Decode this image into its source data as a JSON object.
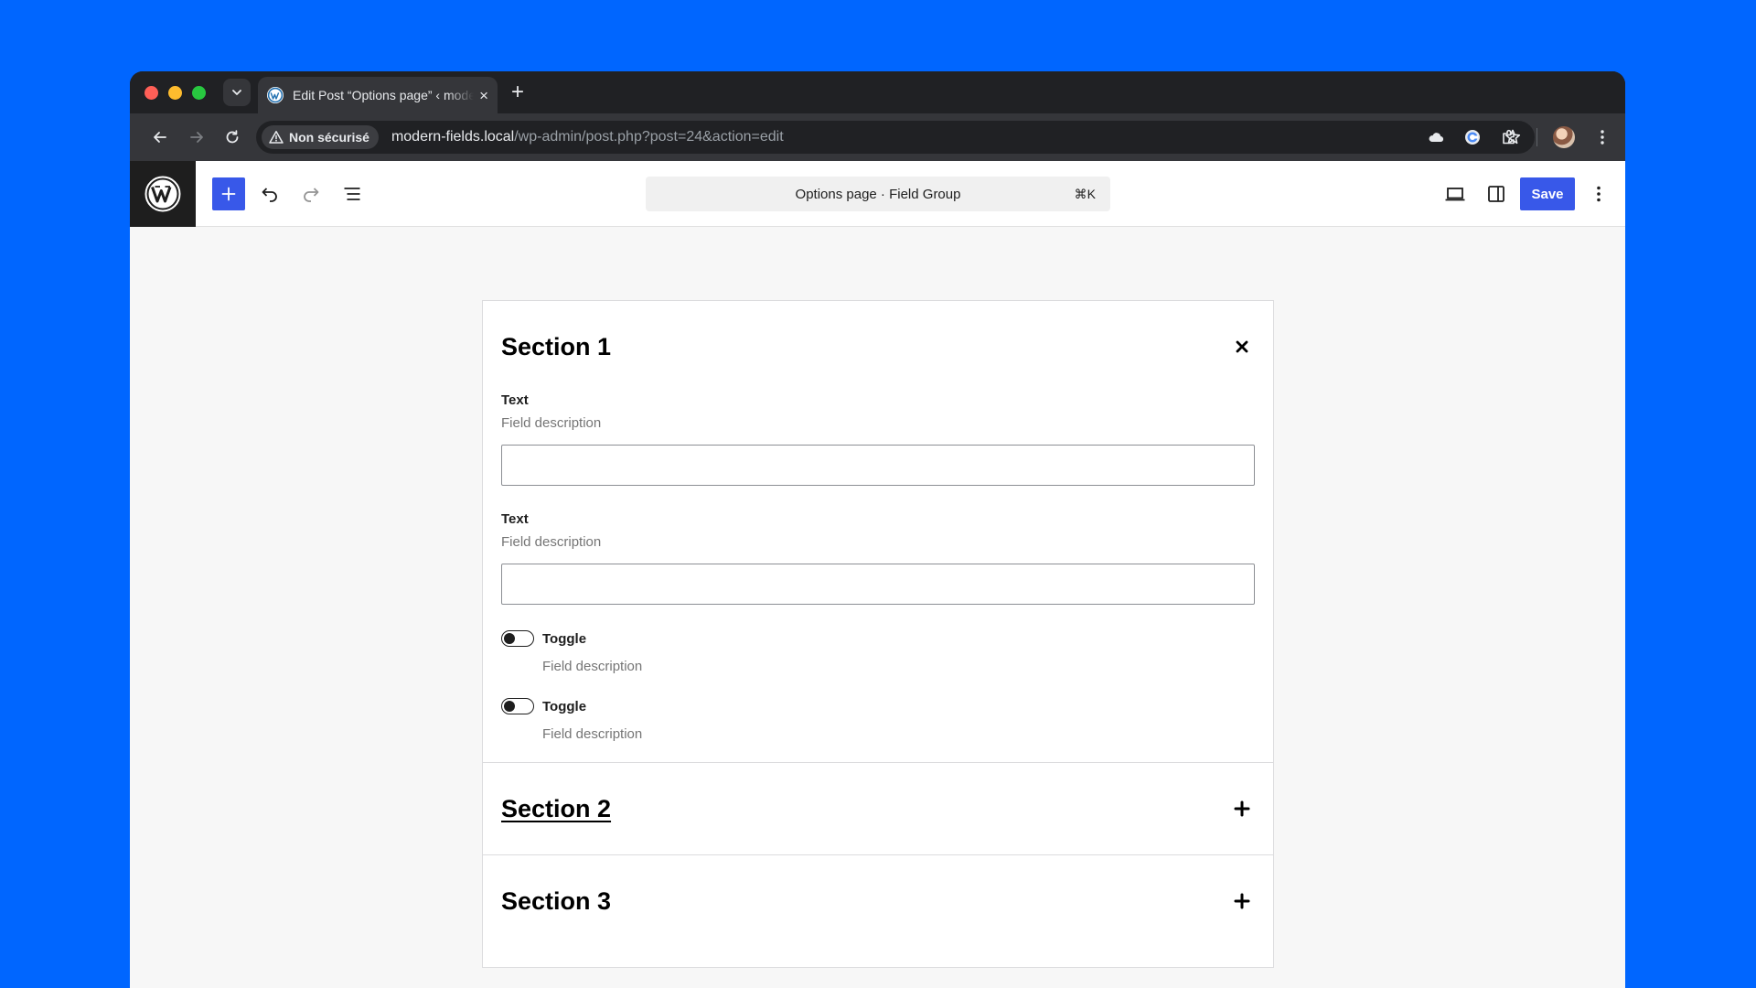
{
  "browser": {
    "tab": {
      "title": "Edit Post “Options page” ‹ modern-fields.local — WordPress",
      "close_glyph": "×"
    },
    "new_tab_glyph": "+",
    "security_label": "Non sécurisé",
    "url_host": "modern-fields.local",
    "url_path": "/wp-admin/post.php?post=24&action=edit"
  },
  "editor": {
    "doc_title": "Options page · Field Group",
    "shortcut": "⌘K",
    "save_label": "Save"
  },
  "sections": [
    {
      "title": "Section 1",
      "expanded": true,
      "fields": [
        {
          "type": "text",
          "label": "Text",
          "description": "Field description",
          "value": ""
        },
        {
          "type": "text",
          "label": "Text",
          "description": "Field description",
          "value": ""
        },
        {
          "type": "toggle",
          "label": "Toggle",
          "description": "Field description",
          "checked": false
        },
        {
          "type": "toggle",
          "label": "Toggle",
          "description": "Field description",
          "checked": false
        }
      ]
    },
    {
      "title": "Section 2",
      "expanded": false
    },
    {
      "title": "Section 3",
      "expanded": false
    }
  ],
  "colors": {
    "background": "#0066ff",
    "wp_accent": "#3858e9",
    "browser_dark": "#202124"
  },
  "icons": {
    "collapse": "close-icon",
    "expand": "plus-icon"
  }
}
